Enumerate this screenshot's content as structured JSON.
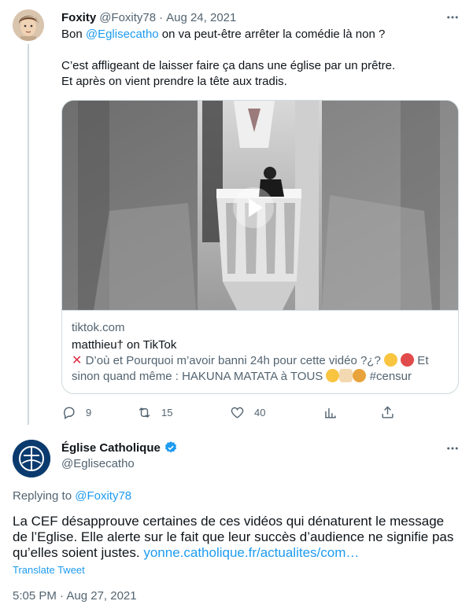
{
  "tweet1": {
    "name": "Foxity",
    "handle": "@Foxity78",
    "dot": "·",
    "date": "Aug 24, 2021",
    "line1_prefix": "Bon ",
    "line1_mention": "@Eglisecatho",
    "line1_suffix": " on va peut-être arrêter la comédie là non ?",
    "line2": "C’est affligeant de laisser faire ça dans une église par un prêtre.",
    "line3": "Et après on vient prendre la tête aux tradis.",
    "card": {
      "domain": "tiktok.com",
      "title": "matthieu† on TikTok",
      "desc_part1": " D’où et Pourquoi m’avoir banni 24h pour cette vidéo ?¿? ",
      "desc_part2": " Et sinon quand même : HAKUNA MATATA à TOUS ",
      "desc_tag": "#censur"
    },
    "actions": {
      "replies": "9",
      "retweets": "15",
      "likes": "40"
    }
  },
  "tweet2": {
    "name": "Église Catholique",
    "handle": "@Eglisecatho",
    "replying_prefix": "Replying to ",
    "replying_mention": "@Foxity78",
    "body": "La CEF désapprouve certaines de ces vidéos qui dénaturent le message de l’Eglise. Elle alerte sur le fait que leur succès d’audience ne signifie pas qu’elles soient justes. ",
    "link": "yonne.catholique.fr/actualites/com…",
    "translate": "Translate Tweet",
    "timestamp": "5:05 PM · Aug 27, 2021"
  },
  "colors": {
    "accent": "#1d9bf0",
    "text": "#0f1419",
    "secondary": "#536471",
    "border": "#cfd9de"
  },
  "icons": [
    "more-icon",
    "play-icon",
    "reply-icon",
    "retweet-icon",
    "like-icon",
    "analytics-icon",
    "share-icon",
    "verified-icon",
    "cross-mark-icon"
  ]
}
